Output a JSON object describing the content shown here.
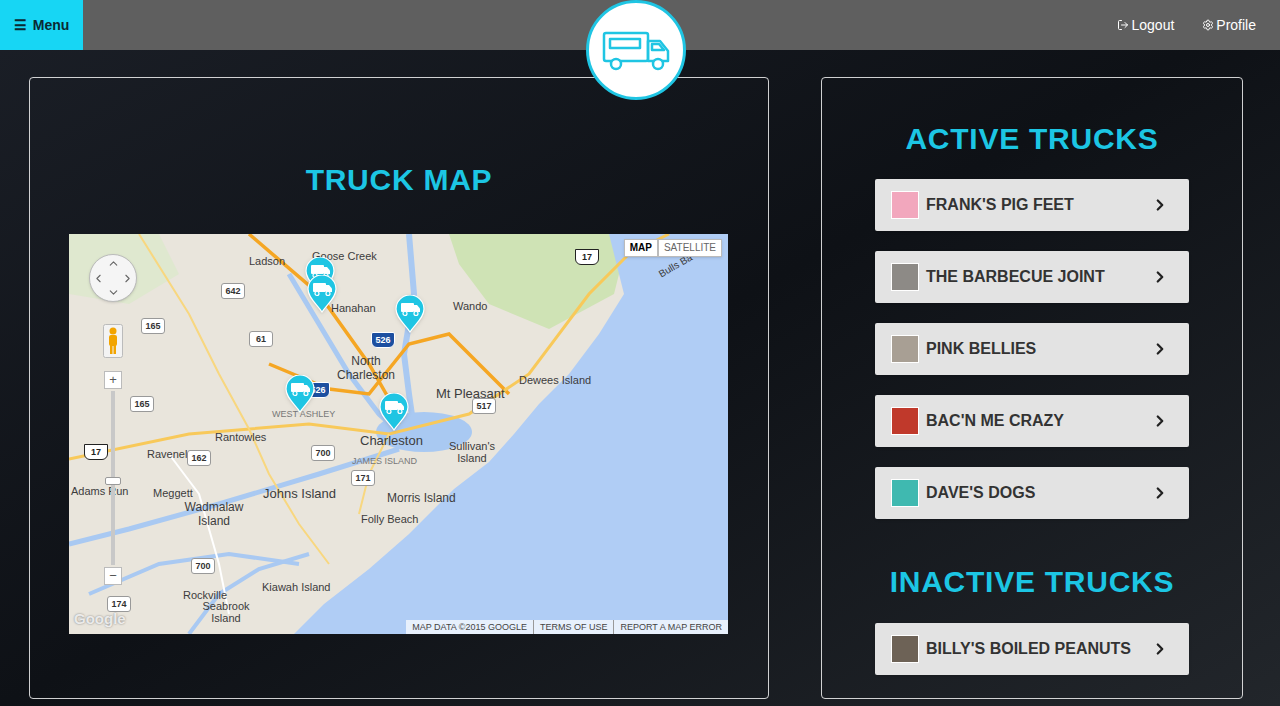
{
  "header": {
    "menu": {
      "icon": "☰",
      "label": "Menu"
    },
    "links": [
      {
        "label": "Logout",
        "kind": "logout"
      },
      {
        "label": "Profile",
        "kind": "profile"
      }
    ]
  },
  "map_panel": {
    "title": "TRUCK MAP",
    "map": {
      "types": [
        {
          "label": "MAP",
          "selected": true
        },
        {
          "label": "SATELLITE",
          "selected": false
        }
      ],
      "zoom": {
        "in": "+",
        "out": "−",
        "level": 0.48
      },
      "places": [
        "Ladson",
        "Goose Creek",
        "Hanahan",
        "Wando",
        "North Charleston",
        "Mt Pleasant",
        "Dewees Island",
        "WEST ASHLEY",
        "Charleston",
        "Sullivan's Island",
        "JAMES ISLAND",
        "Rantowles",
        "Ravenel",
        "Adams Run",
        "Meggett",
        "Johns Island",
        "Morris Island",
        "Wadmalaw Island",
        "Folly Beach",
        "Rockville",
        "Kiawah Island",
        "Seabrook Island",
        "Bulls Ba"
      ],
      "roads": [
        {
          "label": "642",
          "kind": "state"
        },
        {
          "label": "165",
          "kind": "state"
        },
        {
          "label": "61",
          "kind": "state"
        },
        {
          "label": "526",
          "kind": "interstate"
        },
        {
          "label": "17",
          "kind": "us"
        },
        {
          "label": "526",
          "kind": "interstate"
        },
        {
          "label": "165",
          "kind": "state"
        },
        {
          "label": "517",
          "kind": "state"
        },
        {
          "label": "17",
          "kind": "us"
        },
        {
          "label": "162",
          "kind": "state"
        },
        {
          "label": "700",
          "kind": "state"
        },
        {
          "label": "171",
          "kind": "state"
        },
        {
          "label": "700",
          "kind": "state"
        },
        {
          "label": "174",
          "kind": "state"
        }
      ],
      "pins": [
        {
          "kind": "truck"
        },
        {
          "kind": "truck"
        },
        {
          "kind": "truck"
        },
        {
          "kind": "truck"
        },
        {
          "kind": "truck"
        }
      ],
      "attribution": [
        "MAP DATA ©2015 GOOGLE",
        "TERMS OF USE",
        "REPORT A MAP ERROR"
      ],
      "logo": "Google"
    }
  },
  "trucks_panel": {
    "sections": [
      {
        "title": "ACTIVE TRUCKS",
        "trucks": [
          {
            "name": "FRANK'S PIG FEET",
            "thumb_color": "#f2a7bd"
          },
          {
            "name": "THE BARBECUE JOINT",
            "thumb_color": "#8d8a86"
          },
          {
            "name": "PINK BELLIES",
            "thumb_color": "#a89f94"
          },
          {
            "name": "BAC'N ME CRAZY",
            "thumb_color": "#c0392b"
          },
          {
            "name": "DAVE'S DOGS",
            "thumb_color": "#3fb9b0"
          }
        ]
      },
      {
        "title": "INACTIVE TRUCKS",
        "trucks": [
          {
            "name": "BILLY'S BOILED PEANUTS",
            "thumb_color": "#6d6256"
          }
        ]
      }
    ]
  }
}
